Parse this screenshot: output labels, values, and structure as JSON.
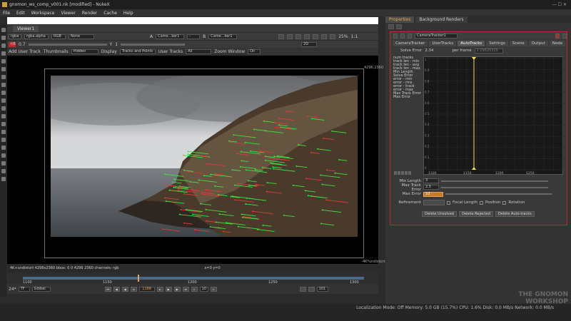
{
  "window": {
    "title": "gnomon_ws_comp_v001.nk [modified] - NukeX"
  },
  "menu": [
    "File",
    "Edit",
    "Workspace",
    "Viewer",
    "Render",
    "Cache",
    "Help"
  ],
  "viewer": {
    "tab_label": "Viewer1",
    "channels": "rgba",
    "alpha": "rgba.alpha",
    "colorspace": "RGB",
    "overlay": "None",
    "input_a": "Came...ker1",
    "input_b": "Came...ker1",
    "zoom": "25%",
    "ratio": "1:1",
    "mode": "2D",
    "gain": "0.7",
    "gamma": "1",
    "fstop_label": "f/8",
    "frame_y": "1",
    "toolbar": {
      "add_user_track": "Add User Track",
      "thumbnails_label": "Thumbnails",
      "thumbnails_value": "Hidden",
      "display_label": "Display",
      "display_value": "Tracks and Points",
      "user_tracks_label": "User Tracks",
      "user_tracks_value": "All",
      "zoom_window_label": "Zoom Window",
      "zoom_window_value": "On"
    },
    "res_top": "4296,2360",
    "res_bottom": "4K*undistort",
    "status_left": "4K+undistort 4296x2360  bbox: 0 0 4296 2360 channels: rgb",
    "status_mid": "x=0 y=0"
  },
  "timeline": {
    "ticks": [
      "1100",
      "1150",
      "1200",
      "1250",
      "1300"
    ],
    "start": "1100",
    "end": "1300",
    "fps": "24*",
    "tf": "TF",
    "scope": "Global",
    "current_frame": "1168",
    "step": "10",
    "end_field": "101"
  },
  "panel": {
    "tabs": [
      "Properties",
      "Background Renders"
    ],
    "node_name": "CameraTracker1",
    "node_tabs": [
      "CameraTracker",
      "UserTracks",
      "AutoTracks",
      "Settings",
      "Scene",
      "Output",
      "Node"
    ],
    "solve_error_label": "Solve Error",
    "solve_error_value": "2.34",
    "per_frame_label": "per frame",
    "per_frame_value": "2.29520315",
    "metrics": [
      "num tracks",
      "track len - min",
      "track len - avg",
      "track len - max",
      "Min Length",
      "Solve Error",
      "error - min",
      "error - rms",
      "error - track",
      "error - max",
      "Max Track Error",
      "Max Error"
    ],
    "graph_ticks": [
      "1100",
      "1150",
      "1200",
      "1250"
    ],
    "graph_y": [
      "1",
      "0.9",
      "0.8",
      "0.7",
      "0.6",
      "0.5",
      "0.4",
      "0.3",
      "0.2",
      "0.1",
      "0"
    ],
    "min_length_label": "Min Length",
    "min_length_value": "3",
    "max_track_error_label": "Max Track Error",
    "max_track_error_value": "2.5",
    "max_error_label": "Max Error",
    "max_error_value": "10",
    "refinement_label": "Refinement",
    "refine_focal": "Focal Length",
    "refine_position": "Position",
    "refine_rotation": "Rotation",
    "btn_unsolved": "Delete Unsolved",
    "btn_rejected": "Delete Rejected",
    "btn_autotracks": "Delete Auto-tracks"
  },
  "status": {
    "text": "Localization Mode: Off  Memory: 5.0 GB (15.7%)  CPU: 1.6%  Disk: 0.0 MB/s  Network: 0.0 MB/s"
  },
  "logo": {
    "line1": "THE GNOMON",
    "line2": "WORKSHOP"
  },
  "colors": {
    "accent": "#e8a060",
    "node_border": "#c0282d",
    "track_green": "#3ee03e",
    "track_red": "#e03a3a",
    "playhead": "#f0e060"
  }
}
